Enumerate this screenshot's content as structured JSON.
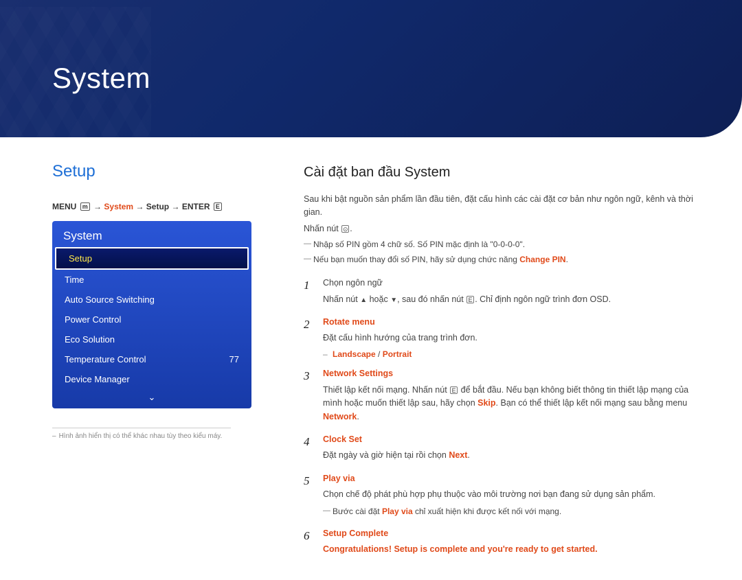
{
  "banner": {
    "title": "System"
  },
  "left": {
    "section_title": "Setup",
    "breadcrumb": {
      "prefix": "MENU",
      "menu_sym": "m",
      "arrow": "→",
      "hl": "System",
      "mid": "Setup",
      "enter": "ENTER",
      "enter_sym": "E"
    },
    "menu": {
      "title": "System",
      "items": [
        {
          "label": "Setup",
          "value": "",
          "selected": true
        },
        {
          "label": "Time",
          "value": ""
        },
        {
          "label": "Auto Source Switching",
          "value": ""
        },
        {
          "label": "Power Control",
          "value": ""
        },
        {
          "label": "Eco Solution",
          "value": ""
        },
        {
          "label": "Temperature Control",
          "value": "77"
        },
        {
          "label": "Device Manager",
          "value": ""
        }
      ]
    },
    "footnote": "Hình ảnh hiển thị có thể khác nhau tùy theo kiểu máy."
  },
  "right": {
    "heading": "Cài đặt ban đầu System",
    "intro1": "Sau khi bật nguồn sản phẩm lần đầu tiên, đặt cấu hình các cài đặt cơ bản như ngôn ngữ, kênh và thời gian.",
    "intro2_a": "Nhấn nút",
    "intro2_sym": "⊙",
    "note1": "Nhập số PIN gồm 4 chữ số. Số PIN mặc định là \"0-0-0-0\".",
    "note2_a": "Nếu bạn muốn thay đổi số PIN, hãy sử dụng chức năng ",
    "note2_b": "Change PIN",
    "note2_c": ".",
    "steps": [
      {
        "num": "1",
        "title": "",
        "lines": [
          "Chọn ngôn ngữ",
          "Nhấn nút ▲ hoặc ▼, sau đó nhấn nút E. Chỉ định ngôn ngữ trình đơn OSD."
        ]
      },
      {
        "num": "2",
        "title": "Rotate menu",
        "lines": [
          "Đặt cấu hình hướng của trang trình đơn."
        ],
        "sub": "Landscape / Portrait"
      },
      {
        "num": "3",
        "title": "Network Settings",
        "lines": [
          "Thiết lập kết nối mạng. Nhấn nút E để bắt đầu. Nếu bạn không biết thông tin thiết lập mạng của mình hoặc muốn thiết lập sau, hãy chọn Skip. Bạn có thể thiết lập kết nối mạng sau bằng menu Network."
        ]
      },
      {
        "num": "4",
        "title": "Clock Set",
        "lines": [
          "Đặt ngày và giờ hiện tại rồi chọn Next."
        ]
      },
      {
        "num": "5",
        "title": "Play via",
        "lines": [
          "Chọn chế độ phát phù hợp phụ thuộc vào môi trường nơi bạn đang sử dụng sản phẩm."
        ],
        "note": "Bước cài đặt Play via chỉ xuất hiện khi được kết nối với mạng."
      },
      {
        "num": "6",
        "title": "Setup Complete",
        "final": "Congratulations! Setup is complete and you're ready to get started."
      }
    ]
  }
}
